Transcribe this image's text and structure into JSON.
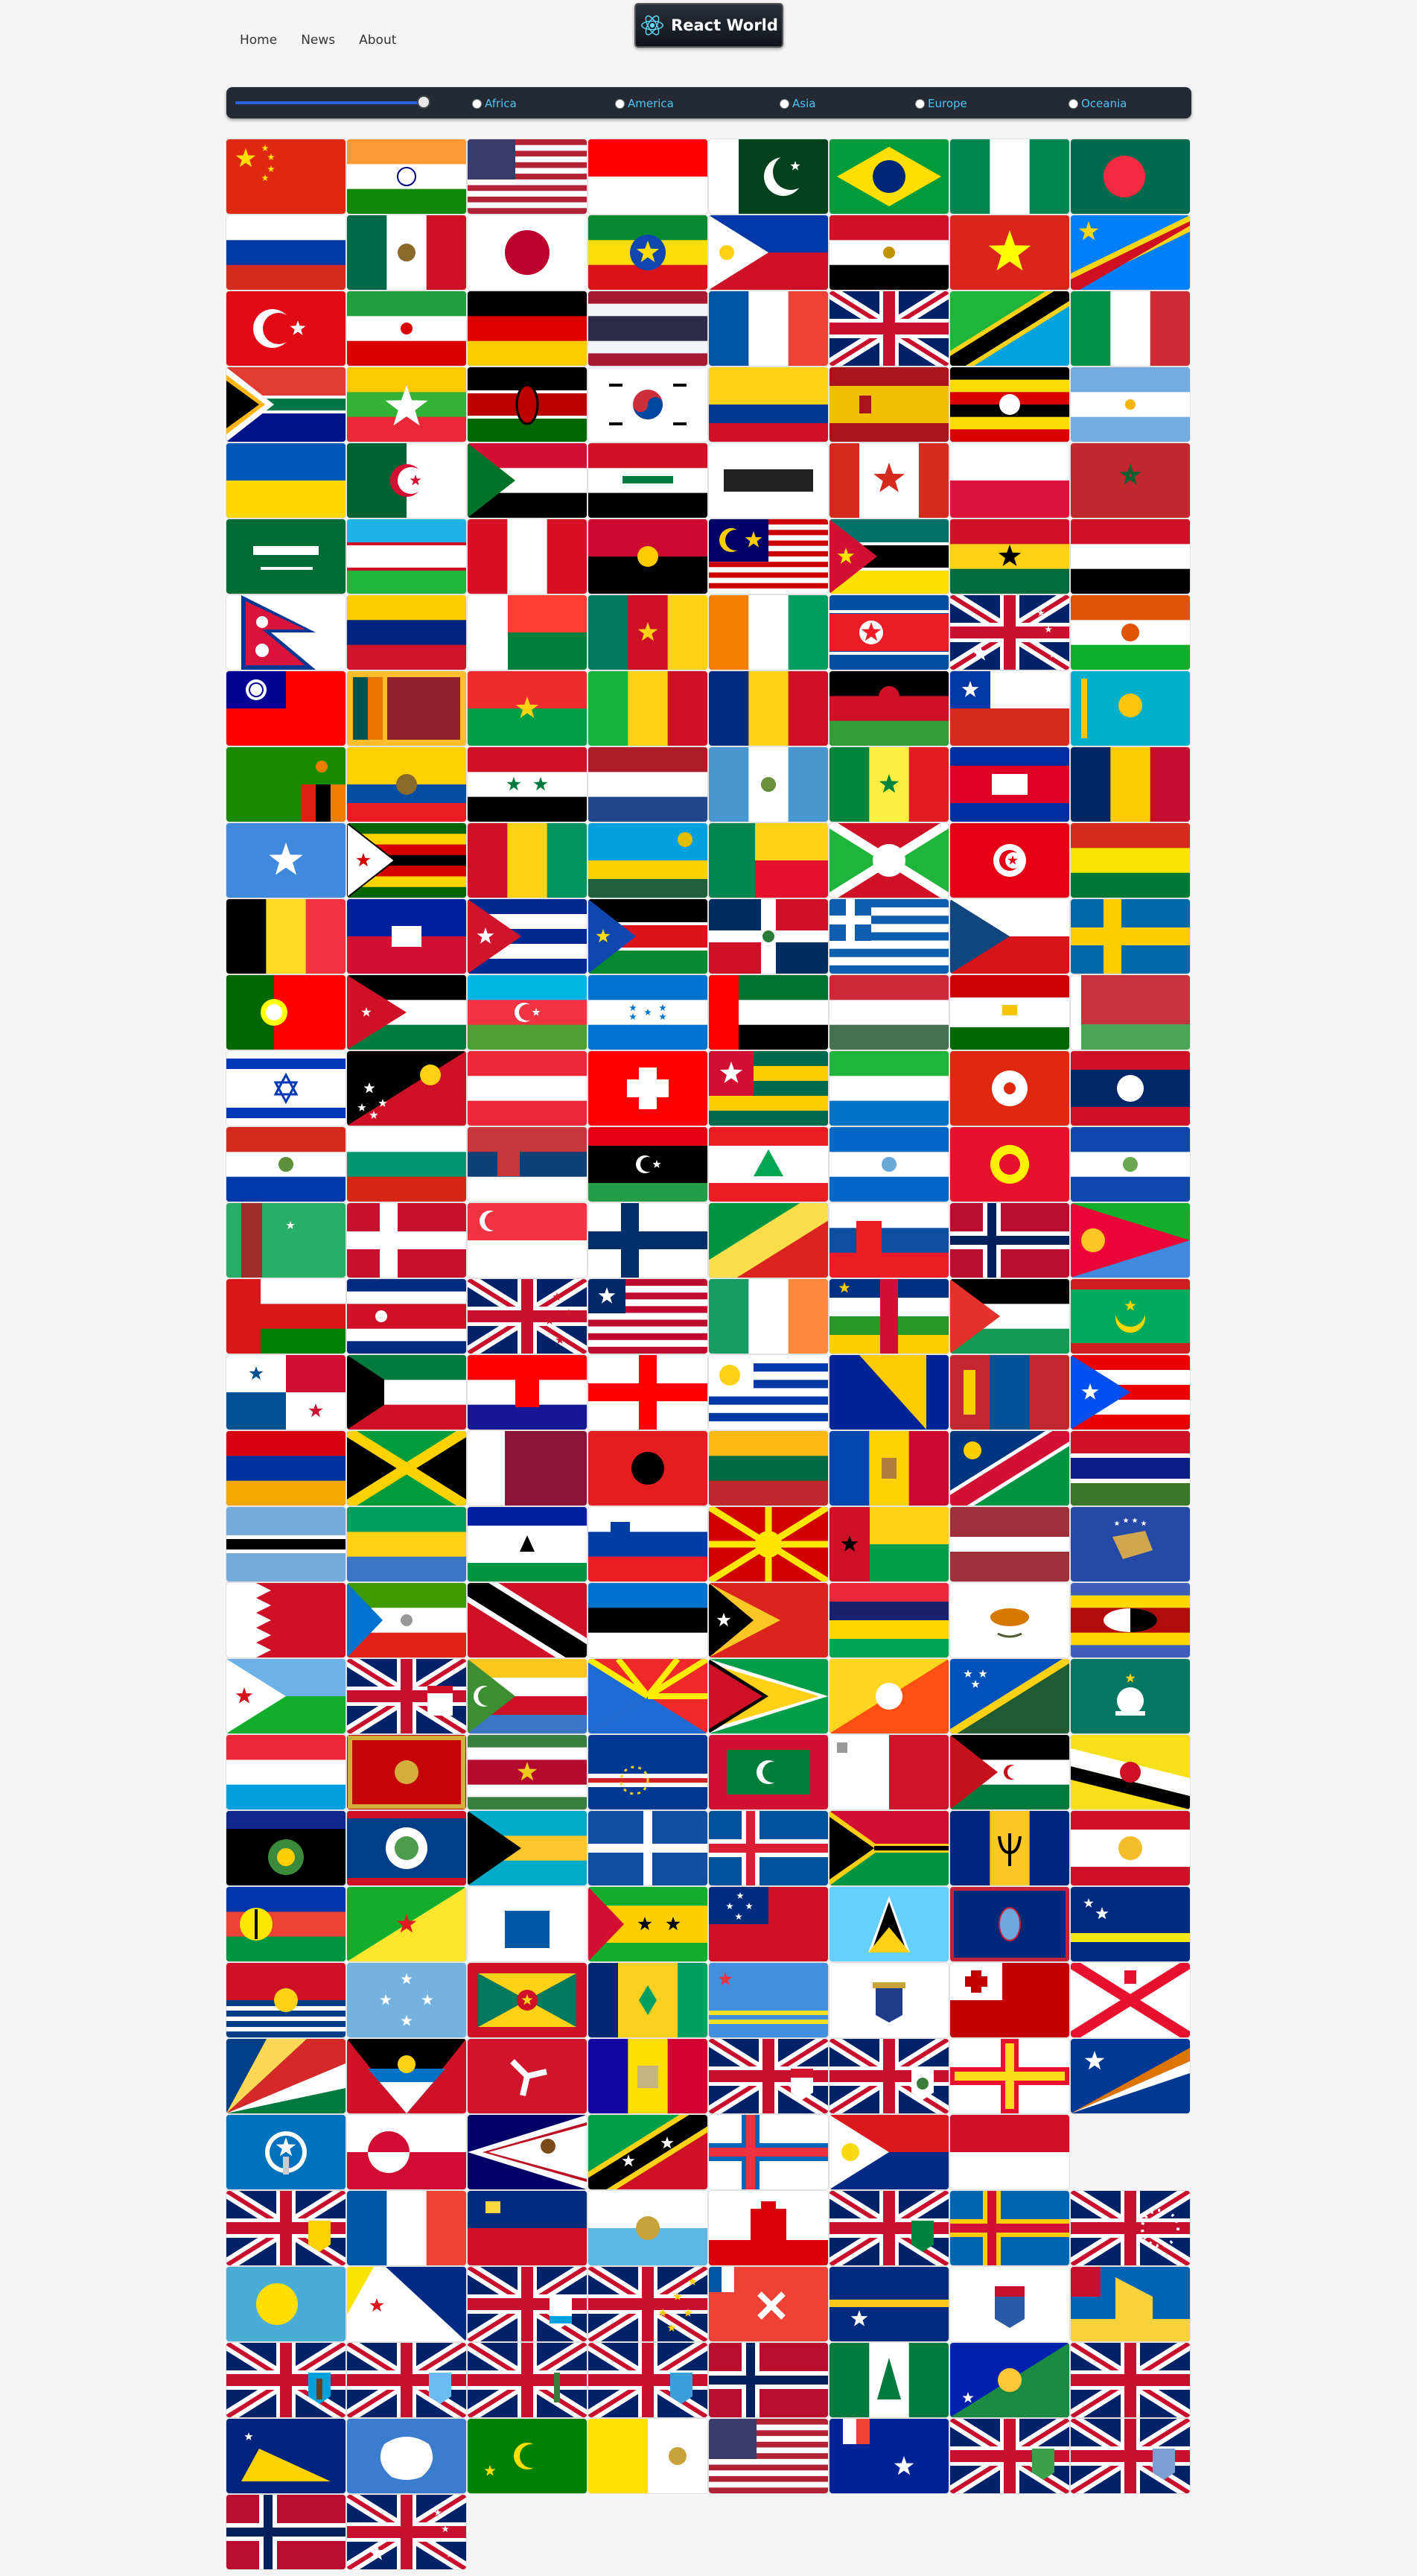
{
  "nav": {
    "items": [
      "Home",
      "News",
      "About"
    ]
  },
  "logo": {
    "title": "React World",
    "icon": "react-atom-icon",
    "accent": "#61dafb"
  },
  "filters": {
    "population_slider_fraction": 1.0,
    "regions": [
      "Africa",
      "America",
      "Asia",
      "Europe",
      "Oceania"
    ],
    "label_color": "#4fc3f7"
  },
  "flags": [
    "China",
    "India",
    "United States",
    "Indonesia",
    "Pakistan",
    "Brazil",
    "Nigeria",
    "Bangladesh",
    "Russia",
    "Mexico",
    "Japan",
    "Ethiopia",
    "Philippines",
    "Egypt",
    "Vietnam",
    "DR Congo",
    "Turkey",
    "Iran",
    "Germany",
    "Thailand",
    "France",
    "United Kingdom",
    "Tanzania",
    "Italy",
    "South Africa",
    "Myanmar",
    "Kenya",
    "South Korea",
    "Colombia",
    "Spain",
    "Uganda",
    "Argentina",
    "Ukraine",
    "Algeria",
    "Sudan",
    "Iraq",
    "Afghanistan",
    "Canada",
    "Poland",
    "Morocco",
    "Saudi Arabia",
    "Uzbekistan",
    "Peru",
    "Angola",
    "Malaysia",
    "Mozambique",
    "Ghana",
    "Yemen",
    "Nepal",
    "Venezuela",
    "Madagascar",
    "Cameroon",
    "Ivory Coast",
    "North Korea",
    "Australia",
    "Niger",
    "Taiwan",
    "Sri Lanka",
    "Burkina Faso",
    "Mali",
    "Romania",
    "Malawi",
    "Chile",
    "Kazakhstan",
    "Zambia",
    "Ecuador",
    "Syria",
    "Netherlands",
    "Guatemala",
    "Senegal",
    "Cambodia",
    "Chad",
    "Somalia",
    "Zimbabwe",
    "Guinea",
    "Rwanda",
    "Benin",
    "Burundi",
    "Tunisia",
    "Bolivia",
    "Belgium",
    "Haiti",
    "Cuba",
    "South Sudan",
    "Dominican Republic",
    "Greece",
    "Czech Republic",
    "Sweden",
    "Portugal",
    "Jordan",
    "Azerbaijan",
    "Honduras",
    "United Arab Emirates",
    "Hungary",
    "Tajikistan",
    "Belarus",
    "Israel",
    "Papua New Guinea",
    "Austria",
    "Switzerland",
    "Togo",
    "Sierra Leone",
    "Hong Kong",
    "Laos",
    "Paraguay",
    "Bulgaria",
    "Serbia",
    "Libya",
    "Lebanon",
    "Nicaragua",
    "Kyrgyzstan",
    "El Salvador",
    "Turkmenistan",
    "Denmark",
    "Singapore",
    "Finland",
    "Republic of the Congo",
    "Slovakia",
    "Norway",
    "Eritrea",
    "Oman",
    "Costa Rica",
    "New Zealand",
    "Liberia",
    "Ireland",
    "Central African Republic",
    "Palestine",
    "Mauritania",
    "Panama",
    "Kuwait",
    "Croatia",
    "Georgia",
    "Uruguay",
    "Bosnia and Herzegovina",
    "Mongolia",
    "Puerto Rico",
    "Armenia",
    "Jamaica",
    "Qatar",
    "Albania",
    "Lithuania",
    "Moldova",
    "Namibia",
    "Gambia",
    "Botswana",
    "Gabon",
    "Lesotho",
    "Slovenia",
    "North Macedonia",
    "Guinea-Bissau",
    "Latvia",
    "Kosovo",
    "Bahrain",
    "Equatorial Guinea",
    "Trinidad and Tobago",
    "Estonia",
    "East Timor",
    "Mauritius",
    "Cyprus",
    "Eswatini",
    "Djibouti",
    "Fiji",
    "Comoros",
    "Reunion",
    "Guyana",
    "Bhutan",
    "Solomon Islands",
    "Macau",
    "Luxembourg",
    "Montenegro",
    "Suriname",
    "Cape Verde",
    "Maldives",
    "Malta",
    "Western Sahara",
    "Brunei",
    "Guadeloupe",
    "Belize",
    "Bahamas",
    "Martinique",
    "Iceland",
    "Vanuatu",
    "Barbados",
    "French Polynesia",
    "New Caledonia",
    "French Guiana",
    "Mayotte",
    "Sao Tome and Principe",
    "Samoa",
    "Saint Lucia",
    "Guam",
    "Curacao",
    "Kiribati",
    "Micronesia",
    "Grenada",
    "Saint Vincent",
    "Aruba",
    "US Virgin Islands",
    "Tonga",
    "Jersey",
    "Seychelles",
    "Antigua and Barbuda",
    "Isle of Man",
    "Andorra",
    "Cayman Islands",
    "Bermuda",
    "Guernsey",
    "Marshall Islands",
    "Northern Mariana Islands",
    "Greenland",
    "American Samoa",
    "Saint Kitts and Nevis",
    "Faroe Islands",
    "Sint Maarten",
    "Monaco",
    "Turks and Caicos",
    "Saint Martin",
    "Liechtenstein",
    "San Marino",
    "Gibraltar",
    "British Virgin Islands",
    "Aland Islands",
    "Cook Islands",
    "Palau",
    "Bonaire",
    "Anguilla",
    "Tuvalu",
    "Wallis and Futuna",
    "Nauru",
    "Saint Barthelemy",
    "Saint Pierre and Miquelon",
    "Montserrat",
    "Saint Helena",
    "British Indian Ocean Territory",
    "Falkland Islands",
    "Svalbard and Jan Mayen",
    "Norfolk Island",
    "Christmas Island",
    "Niue",
    "Tokelau",
    "Antarctica",
    "Cocos Islands",
    "Vatican City",
    "US Minor Outlying Islands",
    "French Southern Territories",
    "Pitcairn Islands",
    "South Georgia",
    "Bouvet Island",
    "Heard Island"
  ]
}
